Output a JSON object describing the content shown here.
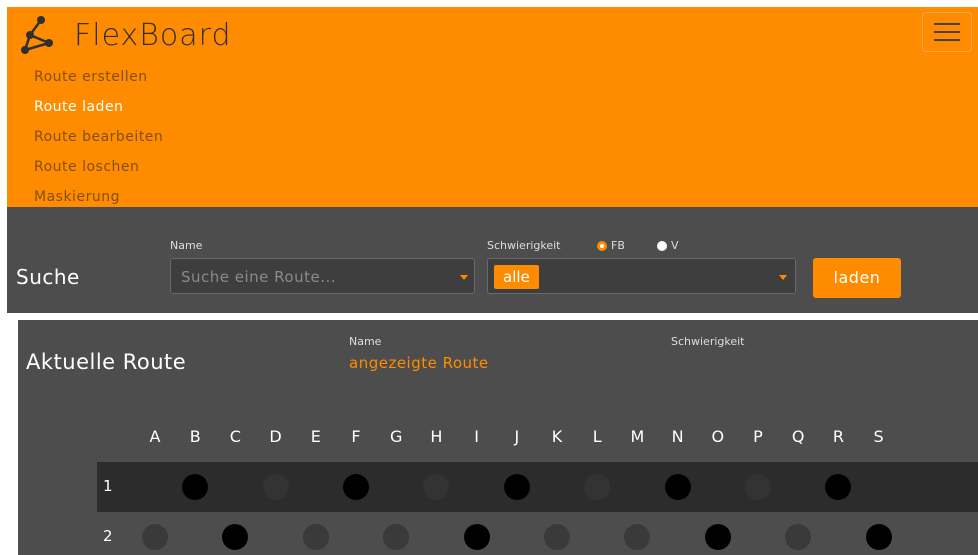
{
  "brand": {
    "name": "FlexBoard"
  },
  "nav": {
    "items": [
      {
        "label": "Route erstellen",
        "state": "dim"
      },
      {
        "label": "Route laden",
        "state": "active"
      },
      {
        "label": "Route bearbeiten",
        "state": "dim"
      },
      {
        "label": "Route loschen",
        "state": "dim"
      },
      {
        "label": "Maskierung",
        "state": "dim"
      }
    ]
  },
  "search": {
    "title": "Suche",
    "name_label": "Name",
    "name_placeholder": "Suche eine Route...",
    "difficulty_label": "Schwierigkeit",
    "difficulty_options": [
      {
        "label": "FB",
        "selected": true
      },
      {
        "label": "V",
        "selected": false
      }
    ],
    "difficulty_value": "alle",
    "load_label": "laden"
  },
  "route": {
    "title": "Aktuelle Route",
    "name_label": "Name",
    "name_value": "angezeigte Route",
    "difficulty_label": "Schwierigkeit"
  },
  "board": {
    "columns": [
      "A",
      "B",
      "C",
      "D",
      "E",
      "F",
      "G",
      "H",
      "I",
      "J",
      "K",
      "L",
      "M",
      "N",
      "O",
      "P",
      "Q",
      "R",
      "S"
    ],
    "rows": [
      {
        "label": "1",
        "holds": [
          "none",
          "black",
          "none",
          "faint",
          "none",
          "black",
          "none",
          "faint",
          "none",
          "black",
          "none",
          "faint",
          "none",
          "black",
          "none",
          "faint",
          "none",
          "black",
          "none"
        ]
      },
      {
        "label": "2",
        "holds": [
          "gray",
          "none",
          "black",
          "none",
          "gray",
          "none",
          "gray",
          "none",
          "black",
          "none",
          "gray",
          "none",
          "gray",
          "none",
          "black",
          "none",
          "gray",
          "none",
          "black"
        ]
      }
    ]
  },
  "colors": {
    "accent": "#ff8c00",
    "panel": "#4d4d4d",
    "dark_row": "#2c2c2c"
  }
}
